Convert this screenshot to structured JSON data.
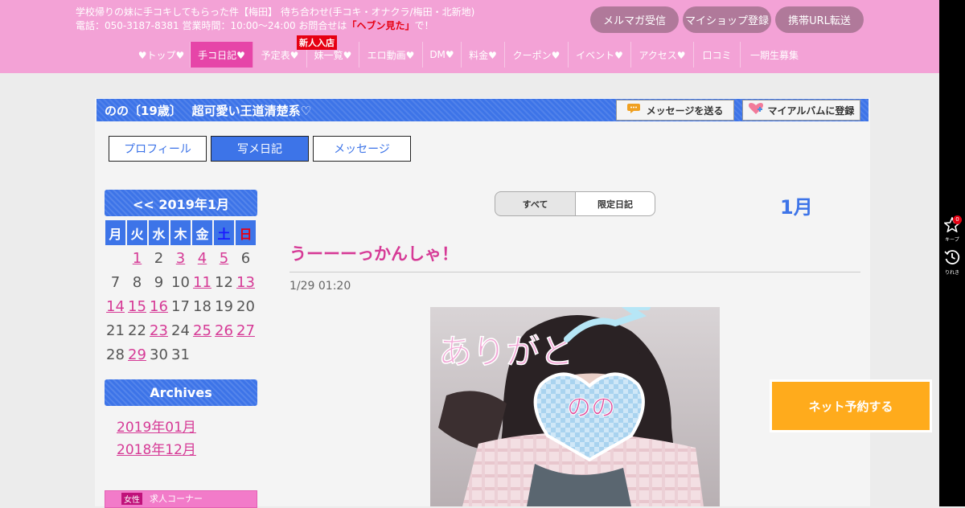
{
  "header": {
    "line1": "学校帰りの妹に手コキしてもらった件【梅田】 待ち合わせ(手コキ・オナクラ/梅田・北新地)",
    "phone_text": "電話：050-3187-8381 営業時間：10:00～24:00 お問合せは",
    "phone_highlight": "「ヘブン見た」",
    "phone_suffix": "で！",
    "buttons": [
      "メルマガ受信",
      "マイショップ登録",
      "携帯URL転送"
    ],
    "new_badge": "新人入店",
    "nav": [
      {
        "label": "♥トップ♥",
        "active": false
      },
      {
        "label": "手コ日記♥",
        "active": true
      },
      {
        "label": "予定表♥",
        "active": false
      },
      {
        "label": "妹一覧♥",
        "active": false
      },
      {
        "label": "エロ動画♥",
        "active": false
      },
      {
        "label": "DM♥",
        "active": false
      },
      {
        "label": "料金♥",
        "active": false
      },
      {
        "label": "クーポン♥",
        "active": false
      },
      {
        "label": "イベント♥",
        "active": false
      },
      {
        "label": "アクセス♥",
        "active": false
      },
      {
        "label": "口コミ",
        "active": false
      },
      {
        "label": "一期生募集",
        "active": false
      }
    ]
  },
  "profile": {
    "title": "のの〔19歳〕　 超可愛い王道清楚系♡",
    "message_button": "メッセージを送る",
    "album_button": "マイアルバムに登録",
    "message_icon": "chat-bubble-icon",
    "album_icon": "heart-icon"
  },
  "tabs": [
    {
      "label": "プロフィール",
      "active": false
    },
    {
      "label": "写メ日記",
      "active": true
    },
    {
      "label": "メッセージ",
      "active": false
    }
  ],
  "calendar": {
    "title": "<< 2019年1月",
    "weekdays": [
      "月",
      "火",
      "水",
      "木",
      "金",
      "土",
      "日"
    ],
    "weeks": [
      [
        null,
        "1",
        "2",
        "3",
        "4",
        "5",
        "6"
      ],
      [
        "7",
        "8",
        "9",
        "10",
        "11",
        "12",
        "13"
      ],
      [
        "14",
        "15",
        "16",
        "17",
        "18",
        "19",
        "20"
      ],
      [
        "21",
        "22",
        "23",
        "24",
        "25",
        "26",
        "27"
      ],
      [
        "28",
        "29",
        "30",
        "31",
        null,
        null,
        null
      ]
    ],
    "linked_days": [
      "1",
      "3",
      "4",
      "5",
      "11",
      "13",
      "14",
      "15",
      "16",
      "23",
      "25",
      "26",
      "27",
      "29"
    ]
  },
  "archives": {
    "title": "Archives",
    "items": [
      "2019年01月",
      "2018年12月"
    ]
  },
  "recruit": {
    "tag": "女性",
    "text": "求人コーナー"
  },
  "filters": {
    "all": "すべて",
    "limited": "限定日記"
  },
  "month_label": "1月",
  "post": {
    "title": "うーーーっかんしゃ！",
    "date": "1/29 01:20",
    "photo_text": "ありがと",
    "photo_name": "のの"
  },
  "reserve_button": "ネット予約する",
  "right_toolbar": {
    "keep_label": "キープ",
    "keep_badge": "0",
    "history_label": "りれき"
  }
}
